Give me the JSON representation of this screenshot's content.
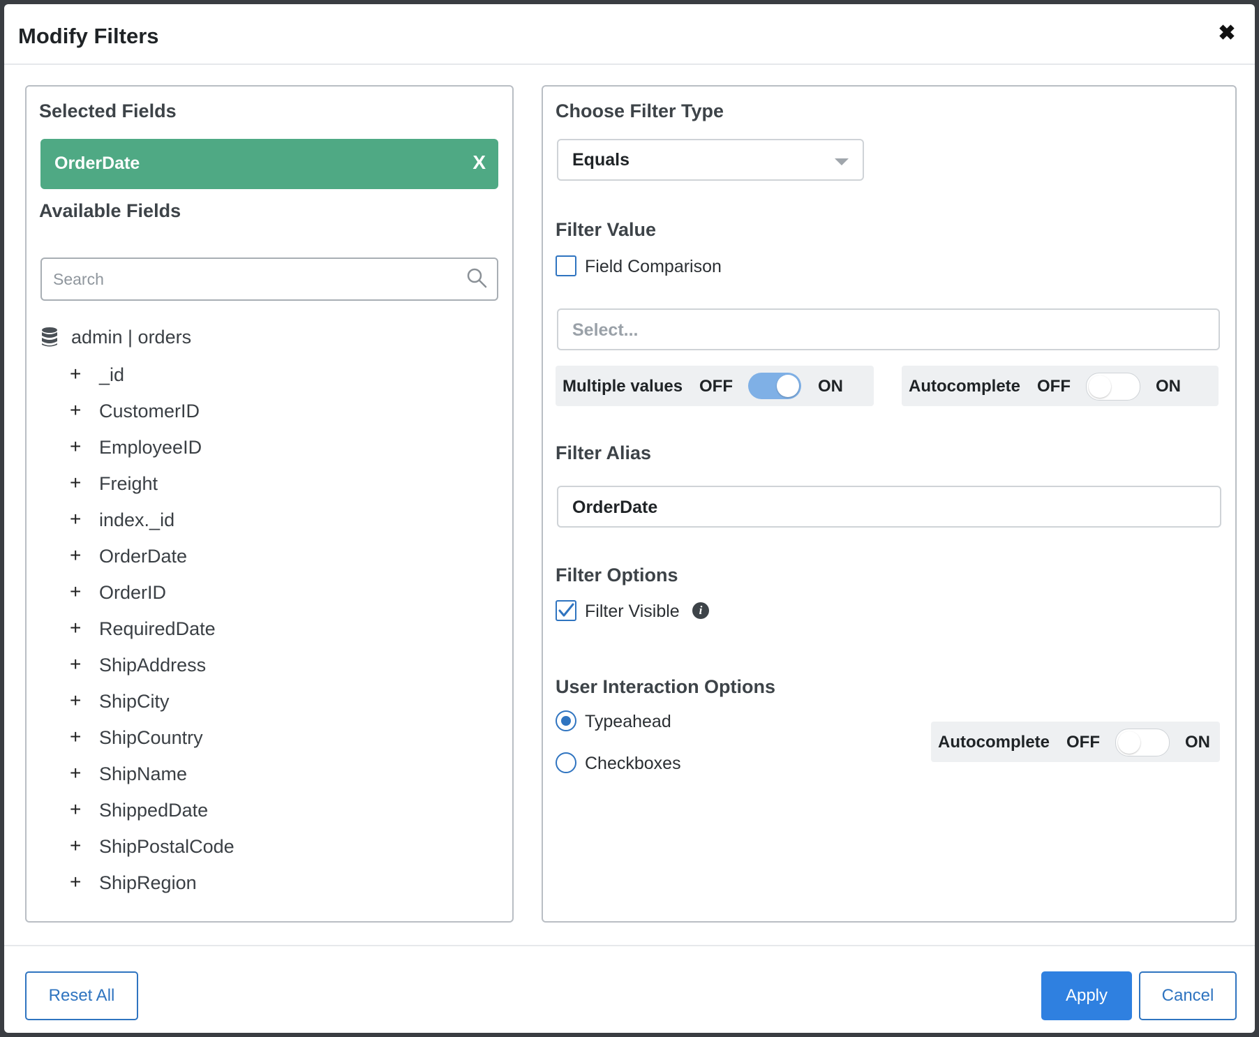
{
  "dialog": {
    "title": "Modify Filters",
    "close_glyph": "✖"
  },
  "left": {
    "selected_heading": "Selected Fields",
    "selected_field": {
      "label": "OrderDate",
      "remove_glyph": "X"
    },
    "available_heading": "Available Fields",
    "search": {
      "placeholder": "Search",
      "value": ""
    },
    "source": "admin | orders",
    "plus_glyph": "+",
    "fields": [
      "_id",
      "CustomerID",
      "EmployeeID",
      "Freight",
      "index._id",
      "OrderDate",
      "OrderID",
      "RequiredDate",
      "ShipAddress",
      "ShipCity",
      "ShipCountry",
      "ShipName",
      "ShippedDate",
      "ShipPostalCode",
      "ShipRegion"
    ]
  },
  "right": {
    "filter_type_heading": "Choose Filter Type",
    "filter_type_value": "Equals",
    "filter_value_heading": "Filter Value",
    "field_comparison_label": "Field Comparison",
    "field_comparison_checked": false,
    "value_select_placeholder": "Select...",
    "multiple_values": {
      "label": "Multiple values",
      "off": "OFF",
      "on": "ON",
      "state": "on"
    },
    "autocomplete_top": {
      "label": "Autocomplete",
      "off": "OFF",
      "on": "ON",
      "state": "off"
    },
    "alias_heading": "Filter Alias",
    "alias_value": "OrderDate",
    "options_heading": "Filter Options",
    "filter_visible_label": "Filter Visible",
    "filter_visible_checked": true,
    "info_glyph": "i",
    "interaction_heading": "User Interaction Options",
    "radio_typeahead": "Typeahead",
    "radio_checkboxes": "Checkboxes",
    "selected_interaction": "Typeahead",
    "autocomplete_bottom": {
      "label": "Autocomplete",
      "off": "OFF",
      "on": "ON",
      "state": "off"
    }
  },
  "footer": {
    "reset_label": "Reset All",
    "apply_label": "Apply",
    "cancel_label": "Cancel"
  },
  "colors": {
    "chip": "#4fa984",
    "accent": "#2f74c0",
    "primary_button": "#2f80e0",
    "toggle_on": "#7fb0e6"
  }
}
